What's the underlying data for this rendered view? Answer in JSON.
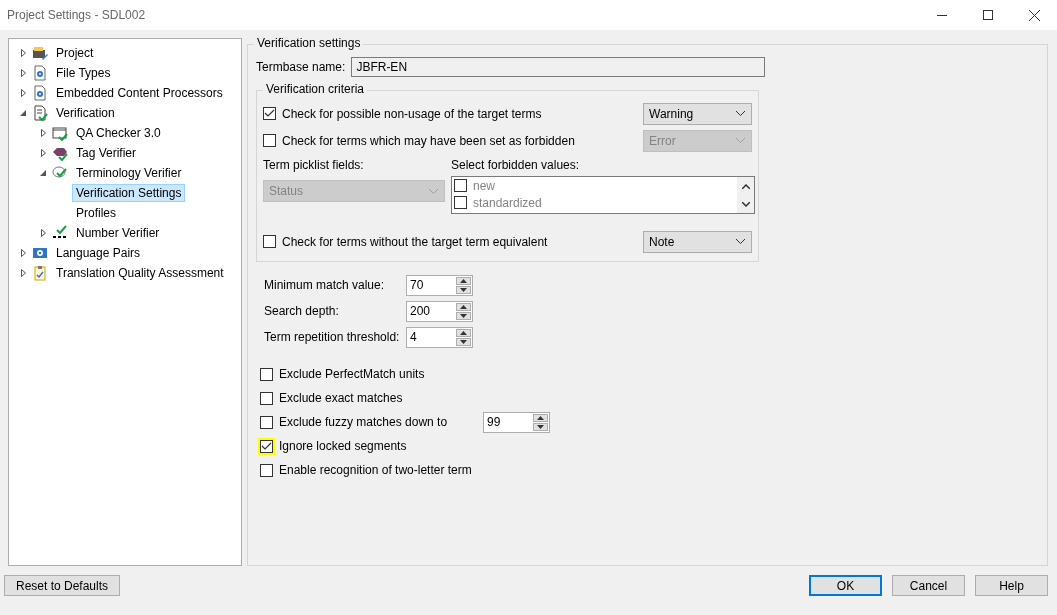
{
  "window": {
    "title": "Project Settings - SDL002"
  },
  "tree": [
    {
      "label": "Project",
      "kind": "project",
      "expandable": true,
      "expanded": false,
      "selected": false
    },
    {
      "label": "File Types",
      "kind": "settings",
      "expandable": true,
      "expanded": false,
      "selected": false
    },
    {
      "label": "Embedded Content Processors",
      "kind": "settings",
      "expandable": true,
      "expanded": false,
      "selected": false
    },
    {
      "label": "Verification",
      "kind": "verification",
      "expandable": true,
      "expanded": true,
      "selected": false,
      "children": [
        {
          "label": "QA Checker 3.0",
          "kind": "qa",
          "expandable": true,
          "expanded": false,
          "selected": false
        },
        {
          "label": "Tag Verifier",
          "kind": "tag",
          "expandable": true,
          "expanded": false,
          "selected": false
        },
        {
          "label": "Terminology Verifier",
          "kind": "terminology",
          "expandable": true,
          "expanded": true,
          "selected": false,
          "children": [
            {
              "label": "Verification Settings",
              "expandable": false,
              "selected": true
            },
            {
              "label": "Profiles",
              "expandable": false,
              "selected": false
            }
          ]
        },
        {
          "label": "Number Verifier",
          "kind": "number",
          "expandable": true,
          "expanded": false,
          "selected": false
        }
      ]
    },
    {
      "label": "Language Pairs",
      "kind": "language",
      "expandable": true,
      "expanded": false,
      "selected": false
    },
    {
      "label": "Translation Quality Assessment",
      "kind": "assessment",
      "expandable": true,
      "expanded": false,
      "selected": false
    }
  ],
  "settings": {
    "title": "Verification settings",
    "termbase": {
      "label": "Termbase name:",
      "value": "JBFR-EN"
    },
    "criteria": {
      "title": "Verification criteria",
      "non_usage": {
        "label": "Check for possible non-usage of the target terms",
        "checked": true,
        "severity": {
          "value": "Warning",
          "disabled": false
        }
      },
      "forbidden": {
        "label": "Check for terms which may have been set as forbidden",
        "checked": false,
        "severity": {
          "value": "Error",
          "disabled": true
        }
      },
      "picklist": {
        "label": "Term picklist fields:",
        "value": "Status",
        "disabled": true
      },
      "forbidden_values": {
        "label": "Select forbidden values:",
        "disabled": true,
        "items": [
          {
            "label": "new",
            "checked": false
          },
          {
            "label": "standardized",
            "checked": false
          }
        ]
      },
      "no_equivalent": {
        "label": "Check for terms without the target term equivalent",
        "checked": false,
        "severity": {
          "value": "Note",
          "disabled": false
        }
      }
    },
    "spinners": [
      {
        "label": "Minimum match value:",
        "value": "70"
      },
      {
        "label": "Search depth:",
        "value": "200"
      },
      {
        "label": "Term repetition threshold:",
        "value": "4"
      }
    ],
    "options": [
      {
        "label": "Exclude PerfectMatch units",
        "checked": false,
        "highlighted": false
      },
      {
        "label": "Exclude exact matches",
        "checked": false,
        "highlighted": false
      },
      {
        "label": "Exclude fuzzy matches down to",
        "checked": false,
        "highlighted": false,
        "value": "99"
      },
      {
        "label": "Ignore locked segments",
        "checked": true,
        "highlighted": true
      },
      {
        "label": "Enable recognition of two-letter term",
        "checked": false,
        "highlighted": false
      }
    ]
  },
  "buttons": {
    "reset": "Reset to Defaults",
    "actions": [
      {
        "label": "OK",
        "default": true
      },
      {
        "label": "Cancel",
        "default": false
      },
      {
        "label": "Help",
        "default": false
      }
    ]
  }
}
